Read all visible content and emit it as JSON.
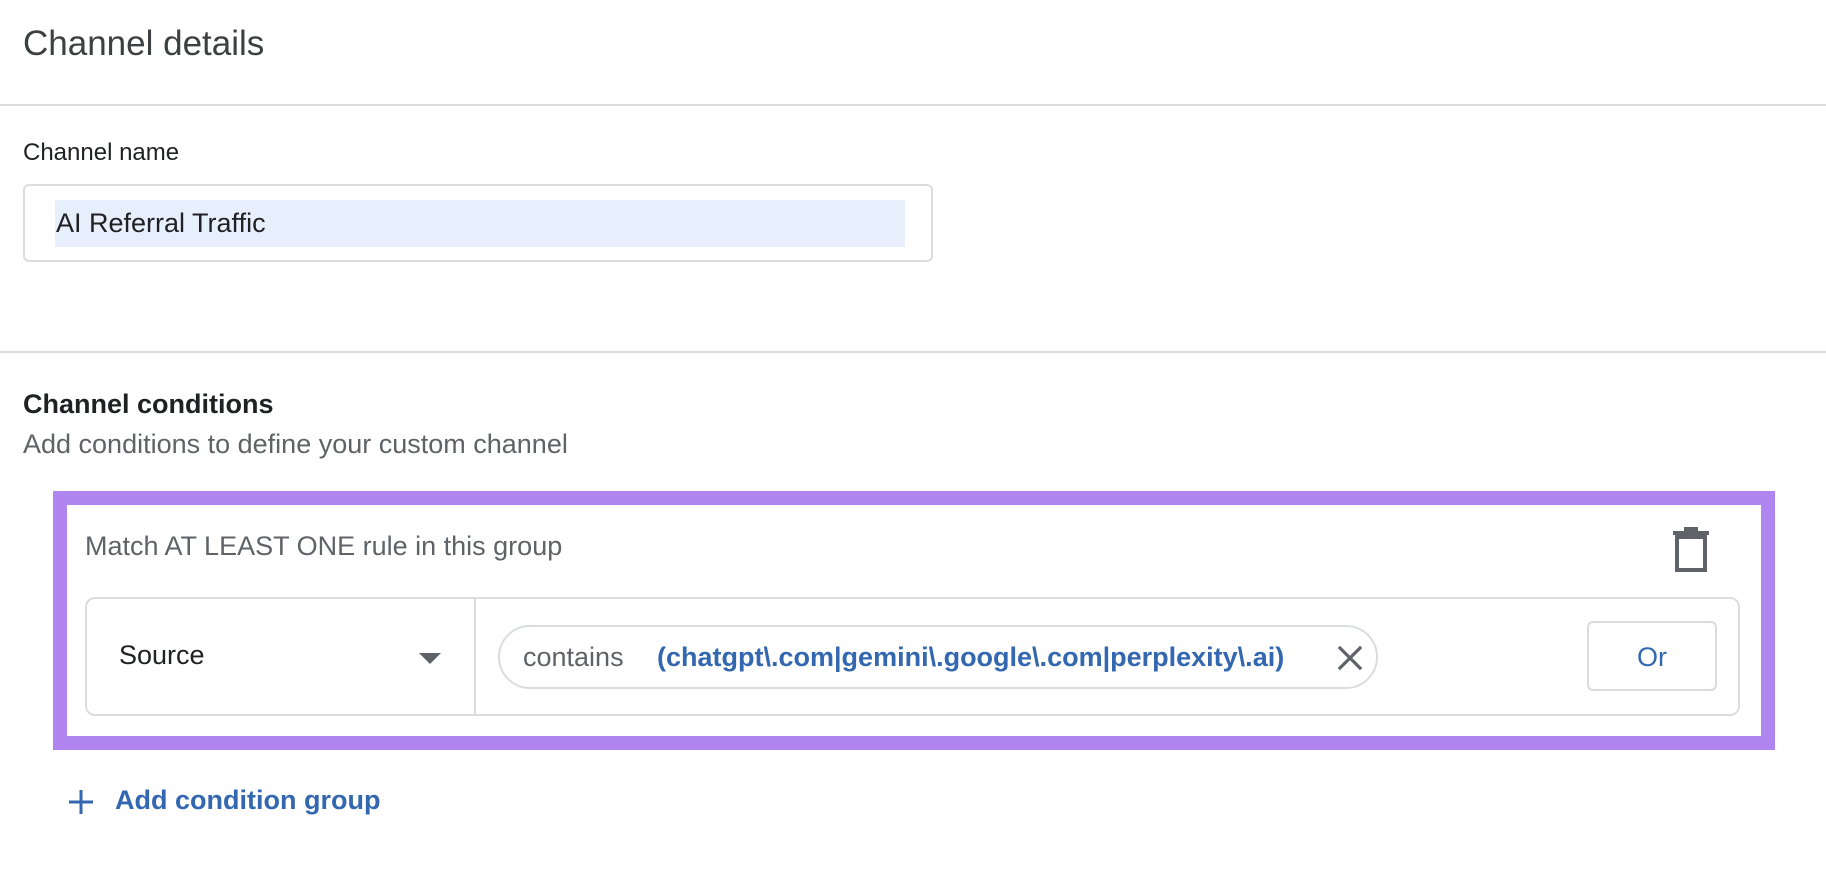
{
  "page_title": "Channel details",
  "channel_name": {
    "label": "Channel name",
    "value": "AI Referral Traffic"
  },
  "conditions": {
    "heading": "Channel conditions",
    "description": "Add conditions to define your custom channel",
    "group": {
      "title": "Match AT LEAST ONE rule in this group",
      "delete_icon": "trash-icon",
      "rule": {
        "dimension": "Source",
        "operator": "contains",
        "value": "(chatgpt\\.com|gemini\\.google\\.com|perplexity\\.ai)",
        "remove_icon": "close-icon",
        "or_label": "Or"
      }
    },
    "add_group_label": "Add condition group",
    "add_group_icon": "plus-icon"
  },
  "colors": {
    "accent": "#3367b0",
    "highlight": "#b085f0",
    "divider": "#dadce0",
    "selection": "#e8effc"
  }
}
